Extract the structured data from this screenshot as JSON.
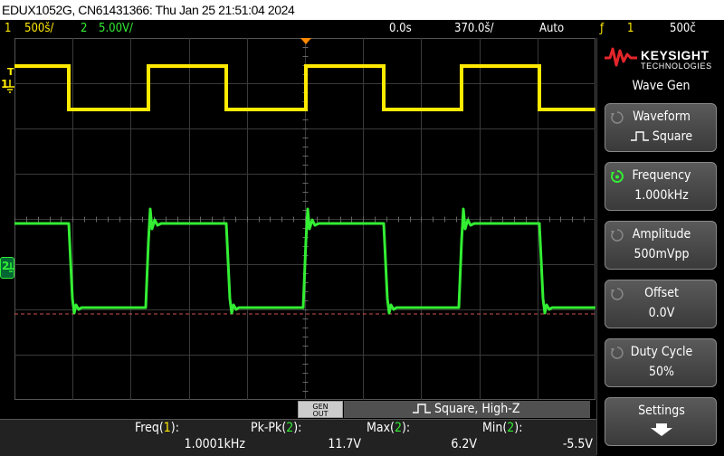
{
  "title_bar": "EDUX1052G, CN61431366: Thu Jan 25 21:51:04 2024",
  "status": {
    "ch1_num": "1",
    "ch1_scale": "500š/",
    "ch2_num": "2",
    "ch2_scale": "5.00V/",
    "time_delay": "0.0s",
    "time_scale": "370.0š/",
    "trigger_mode": "Auto",
    "trigger_icon": "ƒ",
    "trigger_source": "1",
    "trigger_level": "500č"
  },
  "markers": {
    "trig_level": "T",
    "ch1": "1",
    "ch2": "2"
  },
  "sidebar": {
    "brand": "KEYSIGHT",
    "brand_sub": "TECHNOLOGIES",
    "menu_title": "Wave Gen",
    "keys": [
      {
        "label": "Waveform",
        "value": "Square"
      },
      {
        "label": "Frequency",
        "value": "1.000kHz"
      },
      {
        "label": "Amplitude",
        "value": "500mVpp"
      },
      {
        "label": "Offset",
        "value": "0.0V"
      },
      {
        "label": "Duty Cycle",
        "value": "50%"
      },
      {
        "label": "Settings",
        "value": ""
      }
    ]
  },
  "gen_bar": {
    "genout_line1": "GEN",
    "genout_line2": "OUT",
    "description": "Square, High-Z"
  },
  "measurements": [
    {
      "label": "Freq(",
      "ch": "1",
      "end": "):",
      "value": "1.0001kHz"
    },
    {
      "label": "Pk-Pk(",
      "ch": "2",
      "end": "):",
      "value": "11.7V"
    },
    {
      "label": "Max(",
      "ch": "2",
      "end": "):",
      "value": "6.2V"
    },
    {
      "label": "Min(",
      "ch": "2",
      "end": "):",
      "value": "-5.5V"
    }
  ],
  "colors": {
    "ch1": "#ffea00",
    "ch2": "#33ee33",
    "trigger": "#ff8800"
  }
}
